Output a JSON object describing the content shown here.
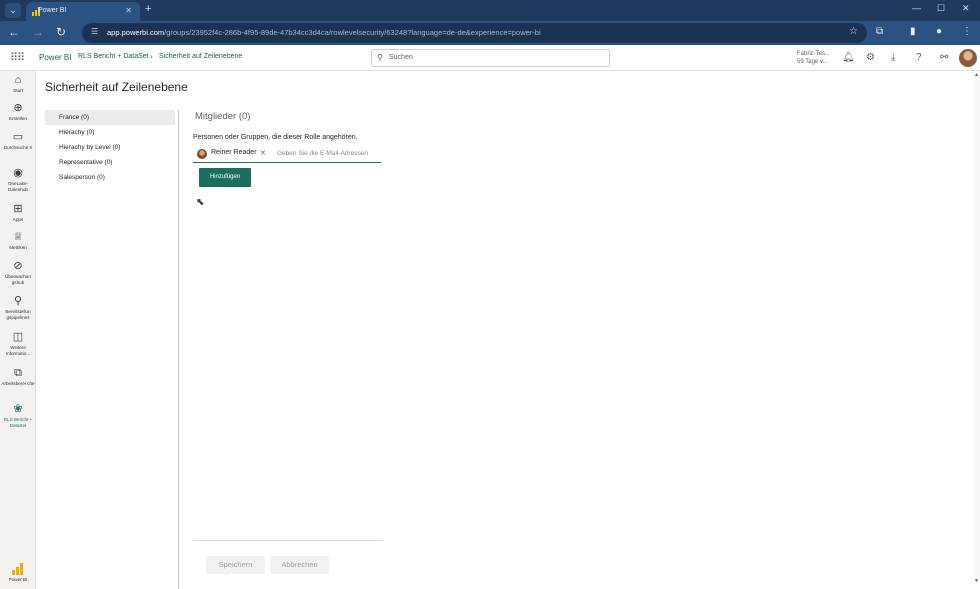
{
  "browser": {
    "tab_title": "Power BI",
    "url_host": "app.powerbi.com",
    "url_path": "/groups/23952f4c-286b-4f95-89de-47b34cc3d4ca/rowlevelsecurity/63248?language=de-de&experience=power-bi"
  },
  "header": {
    "brand": "Power BI",
    "breadcrumb": [
      "RLS Bericht + DataSet",
      "Sicherheit auf Zeilenebene"
    ],
    "search_placeholder": "Suchen",
    "trial_line1": "Fabric-Tes...",
    "trial_line2": "59 Tage v..."
  },
  "leftnav": {
    "items": [
      {
        "label": "Start",
        "icon": "home-icon"
      },
      {
        "label": "Erstellen",
        "icon": "plus-icon"
      },
      {
        "label": "Durchsuche n",
        "icon": "folder-icon"
      },
      {
        "label": "OneLake-Datenhub",
        "icon": "onelake-icon"
      },
      {
        "label": "Apps",
        "icon": "apps-icon"
      },
      {
        "label": "Metriken",
        "icon": "trophy-icon"
      },
      {
        "label": "Überwachun gshub",
        "icon": "monitor-icon"
      },
      {
        "label": "Bereitstellun gspipelines",
        "icon": "rocket-icon"
      },
      {
        "label": "Weitere Informatio...",
        "icon": "book-icon"
      },
      {
        "label": "Arbeitsberei che",
        "icon": "workspace-icon"
      },
      {
        "label": "RLS Bericht + DataSet",
        "icon": "dataset-icon"
      }
    ],
    "bottom_label": "Power BI"
  },
  "page": {
    "title": "Sicherheit auf Zeilenebene",
    "roles": [
      "France (0)",
      "Hierachy (0)",
      "Hierachy by Level (0)",
      "Representative (0)",
      "Salesperson (0)"
    ],
    "selected_role_index": 0,
    "members_title": "Mitglieder (0)",
    "members_description": "Personen oder Gruppen, die dieser Rolle angehören.",
    "chip_name": "Reiner Reader",
    "input_placeholder": "Geben Sie die E-Mail-Adressen",
    "add_button": "Hinzufügen",
    "save_button": "Speichern",
    "cancel_button": "Abbrechen"
  }
}
